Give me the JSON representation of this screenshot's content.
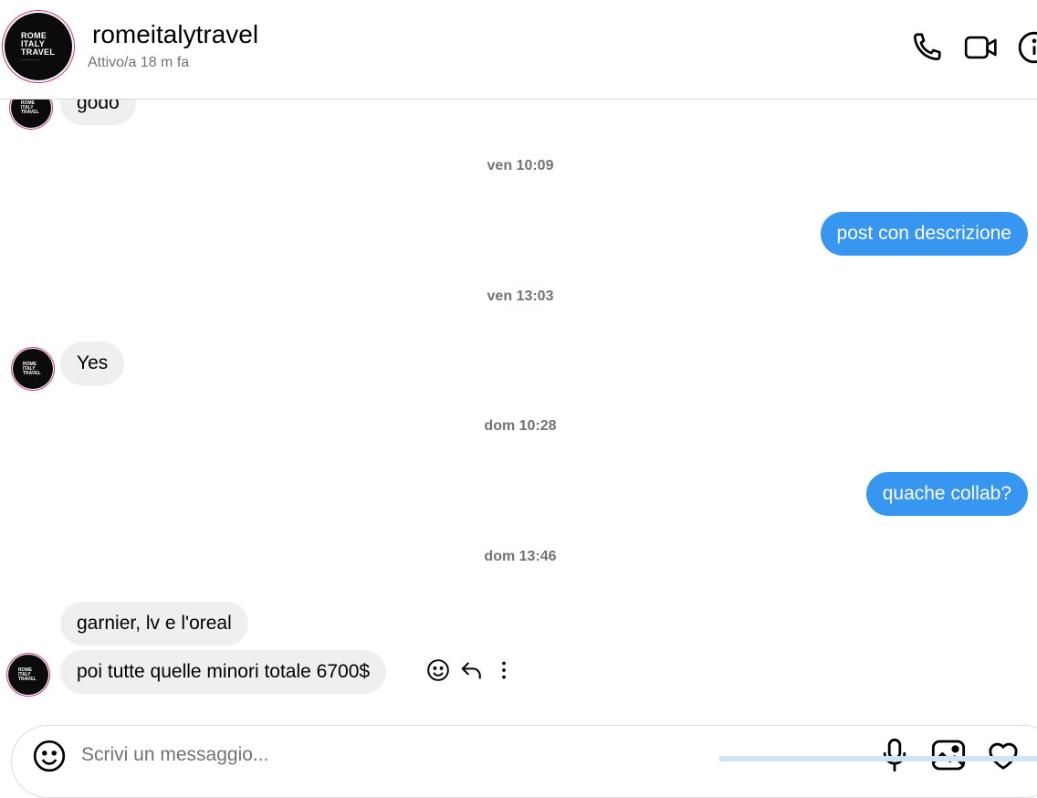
{
  "header": {
    "contact_name": "romeitalytravel",
    "status": "Attivo/a 18 m fa",
    "avatar_lines": [
      "ROME",
      "ITALY",
      "TRAVEL"
    ],
    "icons": [
      "phone-icon",
      "video-icon",
      "info-icon"
    ]
  },
  "messages": {
    "m0_partial": "godo",
    "ts1": "ven 10:09",
    "m1": "post con descrizione",
    "ts2": "ven 13:03",
    "m2": "Yes",
    "ts3": "dom 10:28",
    "m3": "quache collab?",
    "ts4": "dom 13:46",
    "m4": "garnier, lv e l'oreal",
    "m5": "poi tutte quelle minori totale 6700$"
  },
  "message_actions": [
    "emoji-react-icon",
    "reply-icon",
    "more-options-icon"
  ],
  "composer": {
    "placeholder": "Scrivi un messaggio...",
    "icons": [
      "emoji-icon",
      "microphone-icon",
      "image-icon",
      "heart-icon"
    ]
  },
  "colors": {
    "outgoing_bubble": "#3797f0",
    "incoming_bubble": "#efefef",
    "timestamp": "#737373",
    "avatar_ring": "#c13584"
  }
}
